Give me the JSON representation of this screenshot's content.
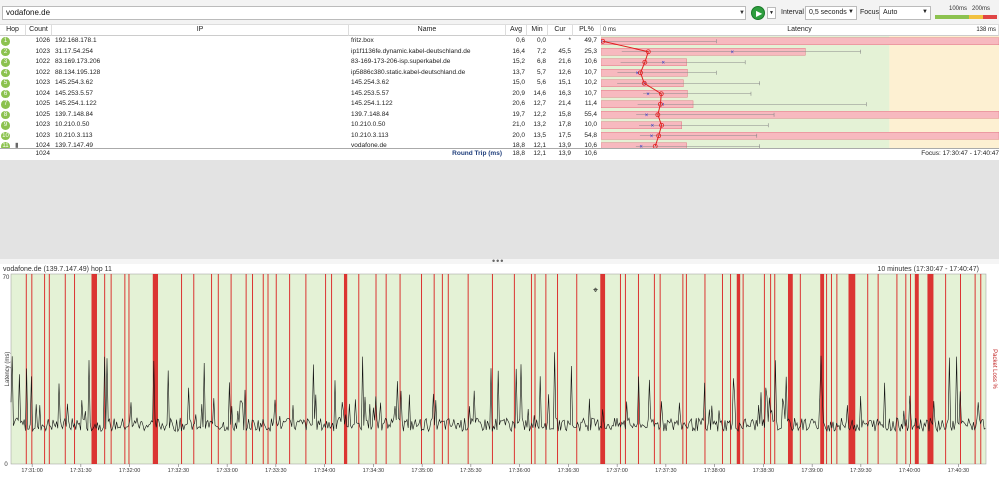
{
  "toolbar": {
    "target": "vodafone.de",
    "interval_label": "Interval",
    "interval_value": "0,5 seconds",
    "focus_label": "Focus",
    "focus_value": "Auto",
    "scale": {
      "t1": "100ms",
      "t2": "200ms"
    },
    "colors": {
      "green": "#8cc24f",
      "yellow": "#f2c240",
      "red": "#e04545"
    }
  },
  "table": {
    "headers": {
      "hop": "Hop",
      "count": "Count",
      "ip": "IP",
      "name": "Name",
      "avg": "Avg",
      "min": "Min",
      "cur": "Cur",
      "pl": "PL%",
      "latency": "Latency"
    },
    "latency_axis": {
      "min": "0 ms",
      "max": "138 ms"
    },
    "rows": [
      {
        "hop": "1",
        "count": "1026",
        "ip": "192.168.178.1",
        "name": "fritz.box",
        "avg": "0,6",
        "min": "0,0",
        "cur": "*",
        "pl": "49,7"
      },
      {
        "hop": "2",
        "count": "1023",
        "ip": "31.17.54.254",
        "name": "ip1f1136fe.dynamic.kabel-deutschland.de",
        "avg": "16,4",
        "min": "7,2",
        "cur": "45,5",
        "pl": "25,3"
      },
      {
        "hop": "3",
        "count": "1022",
        "ip": "83.169.173.206",
        "name": "83-169-173-206-isp.superkabel.de",
        "avg": "15,2",
        "min": "6,8",
        "cur": "21,6",
        "pl": "10,6"
      },
      {
        "hop": "4",
        "count": "1022",
        "ip": "88.134.195.128",
        "name": "ip5886c380.static.kabel-deutschland.de",
        "avg": "13,7",
        "min": "5,7",
        "cur": "12,6",
        "pl": "10,7"
      },
      {
        "hop": "5",
        "count": "1023",
        "ip": "145.254.3.62",
        "name": "145.254.3.62",
        "avg": "15,0",
        "min": "5,6",
        "cur": "15,1",
        "pl": "10,2"
      },
      {
        "hop": "6",
        "count": "1024",
        "ip": "145.253.5.57",
        "name": "145.253.5.57",
        "avg": "20,9",
        "min": "14,6",
        "cur": "16,3",
        "pl": "10,7"
      },
      {
        "hop": "7",
        "count": "1025",
        "ip": "145.254.1.122",
        "name": "145.254.1.122",
        "avg": "20,6",
        "min": "12,7",
        "cur": "21,4",
        "pl": "11,4"
      },
      {
        "hop": "8",
        "count": "1025",
        "ip": "139.7.148.84",
        "name": "139.7.148.84",
        "avg": "19,7",
        "min": "12,2",
        "cur": "15,8",
        "pl": "55,4"
      },
      {
        "hop": "9",
        "count": "1023",
        "ip": "10.210.0.50",
        "name": "10.210.0.50",
        "avg": "21,0",
        "min": "13,2",
        "cur": "17,8",
        "pl": "10,0"
      },
      {
        "hop": "10",
        "count": "1023",
        "ip": "10.210.3.113",
        "name": "10.210.3.113",
        "avg": "20,0",
        "min": "13,5",
        "cur": "17,5",
        "pl": "54,8"
      },
      {
        "hop": "11",
        "count": "1024",
        "ip": "139.7.147.49",
        "name": "vodafone.de",
        "avg": "18,8",
        "min": "12,1",
        "cur": "13,9",
        "pl": "10,6"
      }
    ],
    "summary": {
      "count": "1024",
      "label": "Round Trip (ms)",
      "avg": "18,8",
      "min": "12,1",
      "cur": "13,9",
      "pl": "10,6",
      "focus": "Focus: 17:30:47 - 17:40:47"
    }
  },
  "latency_bars": [
    {
      "min": 0.0,
      "avg": 0.6,
      "cur": 0,
      "max": 40,
      "pl": 49.7
    },
    {
      "min": 7.2,
      "avg": 16.4,
      "cur": 45.5,
      "max": 90,
      "pl": 25.3
    },
    {
      "min": 6.8,
      "avg": 15.2,
      "cur": 21.6,
      "max": 50,
      "pl": 10.6
    },
    {
      "min": 5.7,
      "avg": 13.7,
      "cur": 12.6,
      "max": 40,
      "pl": 10.7
    },
    {
      "min": 5.6,
      "avg": 15.0,
      "cur": 15.1,
      "max": 55,
      "pl": 10.2
    },
    {
      "min": 14.6,
      "avg": 20.9,
      "cur": 16.3,
      "max": 52,
      "pl": 10.7
    },
    {
      "min": 12.7,
      "avg": 20.6,
      "cur": 21.4,
      "max": 92,
      "pl": 11.4
    },
    {
      "min": 12.2,
      "avg": 19.7,
      "cur": 15.8,
      "max": 60,
      "pl": 55.4
    },
    {
      "min": 13.2,
      "avg": 21.0,
      "cur": 17.8,
      "max": 58,
      "pl": 10.0
    },
    {
      "min": 13.5,
      "avg": 20.0,
      "cur": 17.5,
      "max": 54,
      "pl": 54.8
    },
    {
      "min": 12.1,
      "avg": 18.8,
      "cur": 13.9,
      "max": 55,
      "pl": 10.6
    }
  ],
  "timeline": {
    "title": "vodafone.de (139.7.147.49) hop 11",
    "range": "10 minutes (17:30:47 - 17:40:47)",
    "ylabel": "Latency (ms)",
    "y2label": "Packet Loss %",
    "chart_data": {
      "type": "line",
      "ylim": [
        0,
        70
      ],
      "y_ticks": [
        "70",
        "0"
      ],
      "x_ticks": [
        "17:31:00",
        "17:31:30",
        "17:32:00",
        "17:32:30",
        "17:33:00",
        "17:33:30",
        "17:34:00",
        "17:34:30",
        "17:35:00",
        "17:35:30",
        "17:36:00",
        "17:36:30",
        "17:37:00",
        "17:37:30",
        "17:38:00",
        "17:38:30",
        "17:39:00",
        "17:39:30",
        "17:40:00",
        "17:40:30"
      ]
    }
  }
}
